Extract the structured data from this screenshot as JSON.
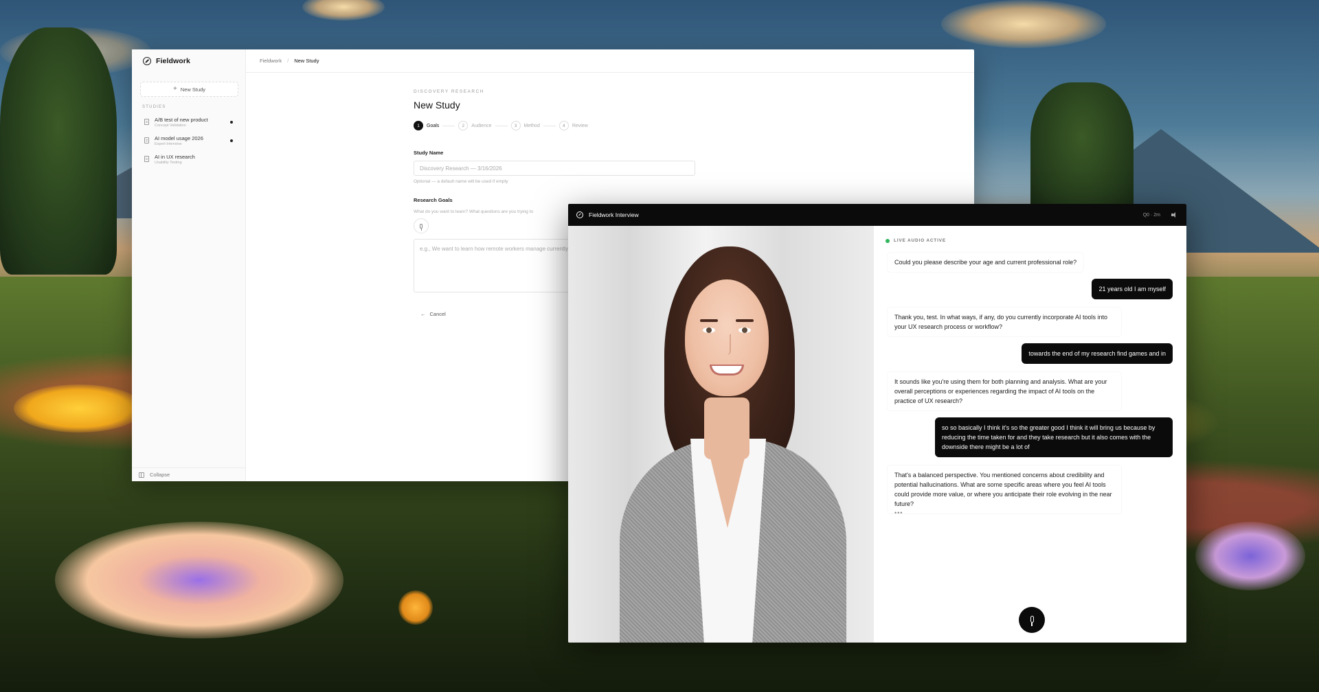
{
  "app": {
    "name": "Fieldwork"
  },
  "sidebar": {
    "new_study_label": "New Study",
    "section_label": "STUDIES",
    "studies": [
      {
        "title": "A/B test of new product",
        "subtitle": "Concept Validation",
        "has_dot": true
      },
      {
        "title": "AI model usage 2026",
        "subtitle": "Expert Interview",
        "has_dot": true
      },
      {
        "title": "AI in UX research",
        "subtitle": "Usability Testing",
        "has_dot": false
      }
    ],
    "collapse_label": "Collapse"
  },
  "breadcrumb": {
    "root": "Fieldwork",
    "separator": "/",
    "current": "New Study"
  },
  "form": {
    "eyebrow": "DISCOVERY RESEARCH",
    "title": "New Study",
    "steps": [
      {
        "num": "1",
        "label": "Goals",
        "active": true
      },
      {
        "num": "2",
        "label": "Audience",
        "active": false
      },
      {
        "num": "3",
        "label": "Method",
        "active": false
      },
      {
        "num": "4",
        "label": "Review",
        "active": false
      }
    ],
    "study_name_label": "Study Name",
    "study_name_placeholder": "Discovery Research — 3/16/2026",
    "study_name_hint": "Optional — a default name will be used if empty",
    "goals_label": "Research Goals",
    "goals_hint": "What do you want to learn? What questions are you trying to",
    "goals_placeholder": "e.g., We want to learn how remote workers manage currently combine...",
    "cancel_label": "Cancel"
  },
  "interview": {
    "title": "Fieldwork Interview",
    "timer": "Q0 · 2m",
    "live_label": "LIVE AUDIO ACTIVE",
    "live_color": "#2fb55b",
    "messages": [
      {
        "role": "ai",
        "text": "Could you please describe your age and current professional role?"
      },
      {
        "role": "user",
        "text": "21 years old I am myself"
      },
      {
        "role": "ai",
        "text": "Thank you, test. In what ways, if any, do you currently incorporate AI tools into your UX research process or workflow?"
      },
      {
        "role": "user",
        "text": "towards the end of my research find games and in"
      },
      {
        "role": "ai",
        "text": "It sounds like you're using them for both planning and analysis. What are your overall perceptions or experiences regarding the impact of AI tools on the practice of UX research?"
      },
      {
        "role": "user",
        "text": "so so basically I think it's so the greater good I think it will bring us because by reducing the time taken for and they take research but it also comes with the downside there might be a lot of"
      },
      {
        "role": "ai",
        "text": "That's a balanced perspective. You mentioned concerns about credibility and potential hallucinations. What are some specific areas where you feel AI tools could provide more value, or where you anticipate their role evolving in the near future?"
      }
    ],
    "typing_indicator": "•••"
  },
  "icons": {
    "brand": "fieldwork-logo-icon",
    "new_study": "plus-icon",
    "study": "document-icon",
    "collapse": "sidebar-collapse-icon",
    "cancel": "arrow-left-icon",
    "mic": "microphone-icon",
    "speaker": "speaker-icon"
  }
}
